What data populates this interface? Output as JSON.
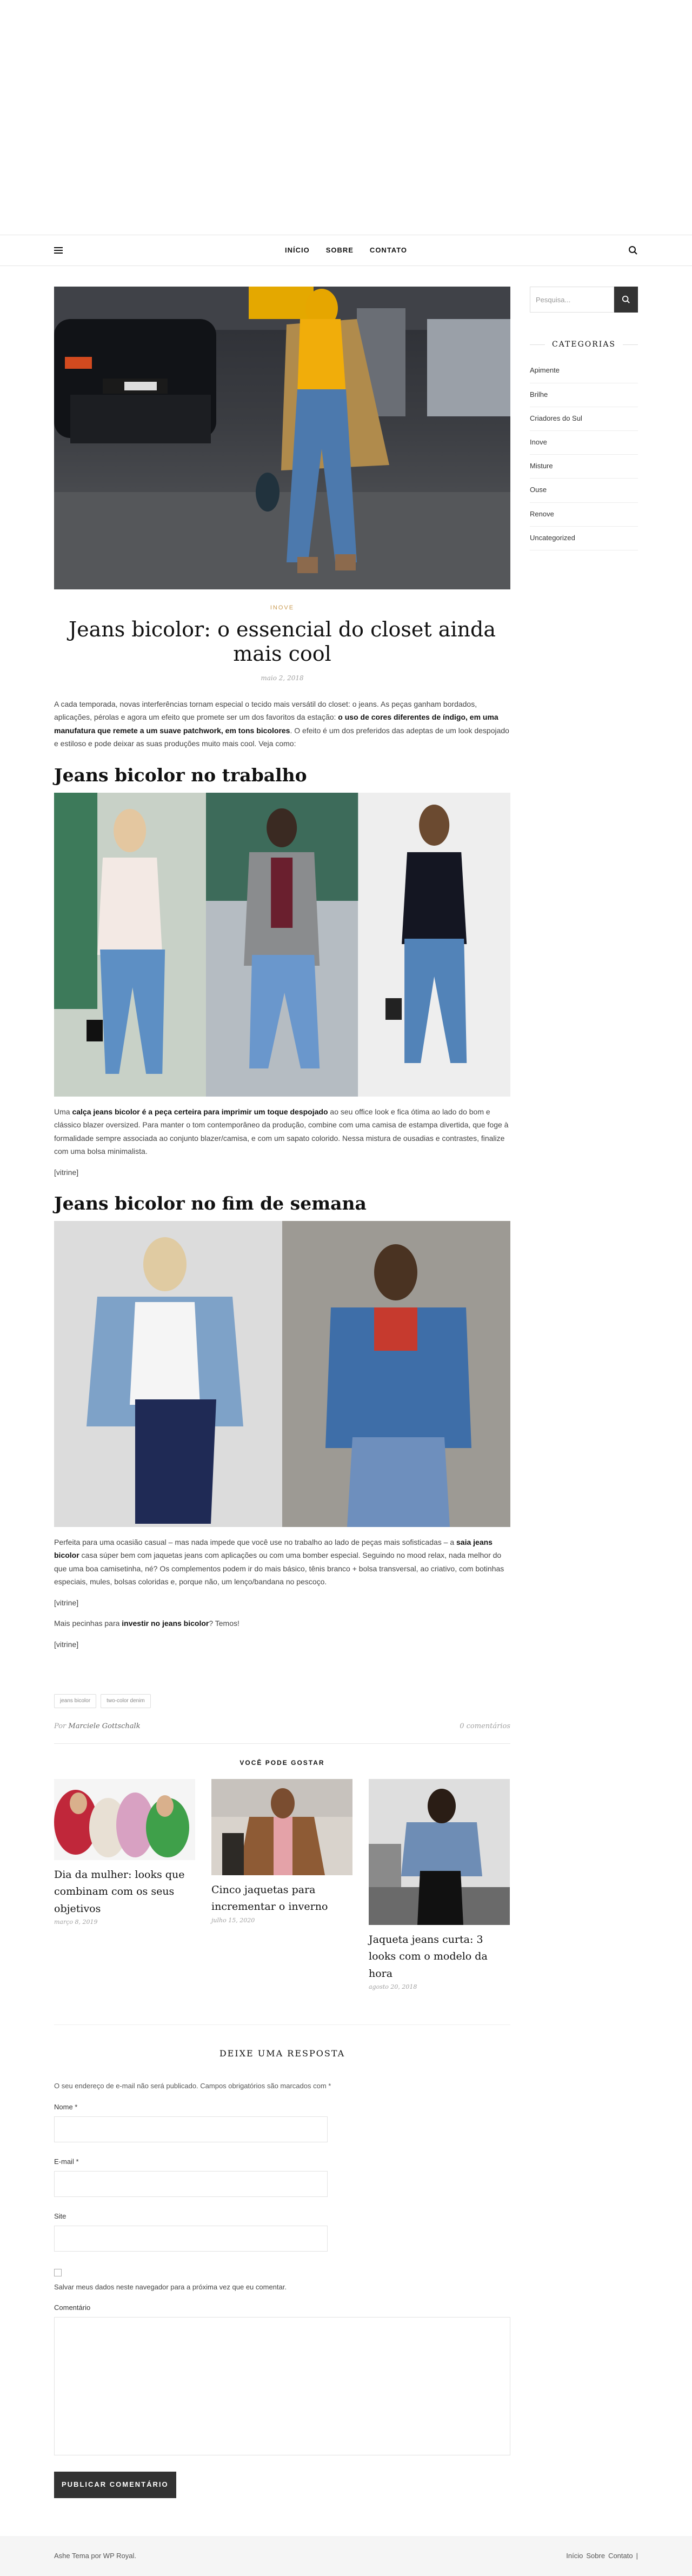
{
  "nav": {
    "items": [
      "INÍCIO",
      "SOBRE",
      "CONTATO"
    ]
  },
  "post": {
    "category": "INOVE",
    "title": "Jeans bicolor: o essencial do closet ainda mais cool",
    "date": "maio 2, 2018",
    "intro_a": "A cada temporada, novas interferências tornam especial o tecido mais versátil do closet: o jeans. As peças ganham bordados, aplicações, pérolas e agora um efeito que promete ser um dos favoritos da estação: ",
    "intro_b": "o uso de cores diferentes de índigo, em uma manufatura que remete a um suave patchwork, em tons bicolores",
    "intro_c": ". O efeito é um dos preferidos das adeptas de um look despojado e estiloso e pode deixar as suas produções muito mais cool. Veja como:",
    "h2_work": "Jeans bicolor no trabalho",
    "work_a": "Uma ",
    "work_b": "calça jeans bicolor é a peça certeira para imprimir um toque despojado",
    "work_c": " ao seu office look e fica ótima ao lado do bom e clássico blazer oversized. Para manter o tom contemporâneo da produção, combine com uma camisa de estampa divertida, que foge à formalidade sempre associada ao conjunto blazer/camisa, e com um sapato colorido. Nessa mistura de ousadias e contrastes, finalize com uma bolsa minimalista.",
    "vitrine1": "[vitrine]",
    "h2_weekend": "Jeans bicolor no fim de semana",
    "weekend_a": "Perfeita para uma ocasião casual – mas nada impede que você use no trabalho ao lado de peças mais sofisticadas – a ",
    "weekend_b": "saia jeans bicolor",
    "weekend_c": " casa súper bem com jaquetas jeans com aplicações ou com uma bomber especial. Seguindo no mood relax, nada melhor do que uma boa camisetinha, né? Os complementos podem ir do mais básico, tênis branco + bolsa transversal, ao criativo, com botinhas especiais, mules, bolsas coloridas e, porque não, um lenço/bandana no pescoço.",
    "vitrine2": "[vitrine]",
    "more_a": "Mais pecinhas para ",
    "more_b": "investir no jeans bicolor",
    "more_c": "? Temos!",
    "vitrine3": "[vitrine]",
    "tags": [
      "jeans bicolor",
      "two-color denim"
    ],
    "by": "Por",
    "author": "Marciele Gottschalk",
    "comments": "0 comentários"
  },
  "related": {
    "title": "VOCÊ PODE GOSTAR",
    "items": [
      {
        "title": "Dia da mulher: looks que combinam com os seus objetivos",
        "date": "março 8, 2019"
      },
      {
        "title": "Cinco jaquetas para incrementar o inverno",
        "date": "julho 15, 2020"
      },
      {
        "title": "Jaqueta jeans curta: 3 looks com o modelo da hora",
        "date": "agosto 20, 2018"
      }
    ]
  },
  "reply": {
    "title": "DEIXE UMA RESPOSTA",
    "notes": "O seu endereço de e-mail não será publicado. Campos obrigatórios são marcados com *",
    "name_label": "Nome *",
    "email_label": "E-mail *",
    "site_label": "Site",
    "save_label": "Salvar meus dados neste navegador para a próxima vez que eu comentar.",
    "comment_label": "Comentário",
    "submit": "PUBLICAR COMENTÁRIO"
  },
  "sidebar": {
    "search_placeholder": "Pesquisa...",
    "categories_title": "CATEGORIAS",
    "categories": [
      "Apimente",
      "Brilhe",
      "Criadores do Sul",
      "Inove",
      "Misture",
      "Ouse",
      "Renove",
      "Uncategorized"
    ]
  },
  "footer": {
    "credit": "Ashe Tema por WP Royal.",
    "links": [
      "Início",
      "Sobre",
      "Contato"
    ],
    "sep": "|"
  },
  "colors": {
    "accent": "#ca9b52",
    "dark": "#333333"
  }
}
